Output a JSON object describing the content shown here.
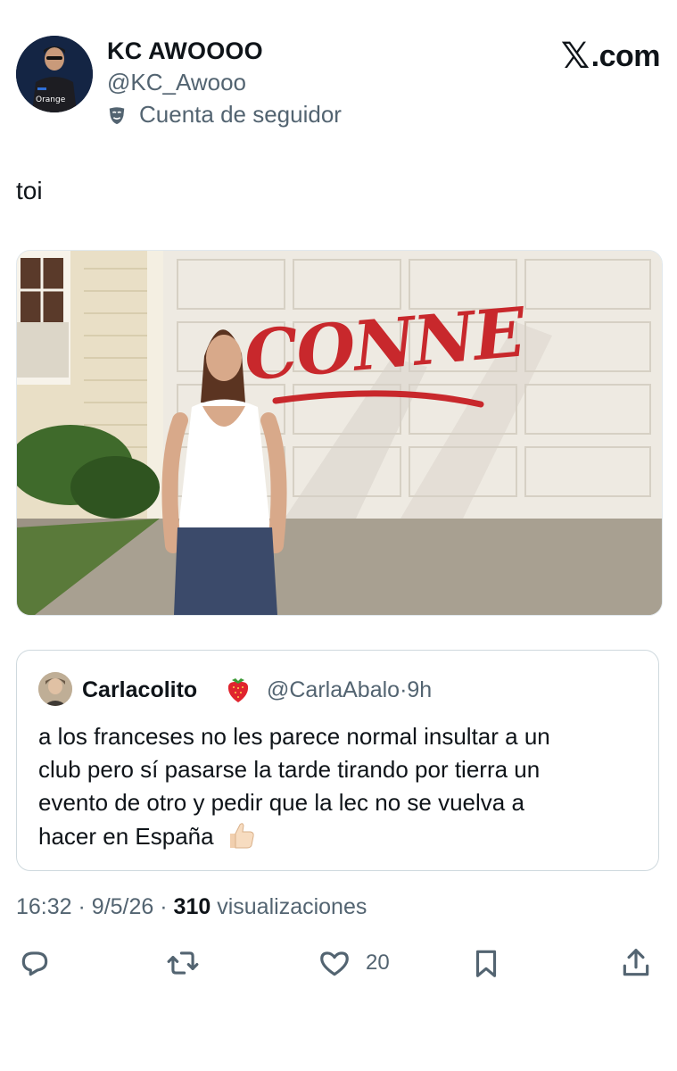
{
  "author": {
    "display_name": "KC AWOOOO",
    "handle": "@KC_Awooo",
    "account_type_label": "Cuenta de seguidor",
    "account_type_icon": "mask-icon"
  },
  "brand": {
    "x_glyph": "𝕏",
    "label": ".com"
  },
  "tweet": {
    "text": "toi",
    "media": {
      "description_icon": "photo",
      "painted_word": "CONNE"
    }
  },
  "quoted": {
    "display_name": "Carlacolito",
    "emoji": "strawberry",
    "handle": "@CarlaAbalo",
    "separator": "·",
    "time": "9h",
    "lines": [
      "a los franceses no les parece normal insultar a un",
      "club pero sí pasarse la tarde tirando por tierra un",
      "evento de otro y pedir que la lec no se vuelva a",
      "hacer en España"
    ],
    "trailing_emoji": "thumbs-up"
  },
  "meta": {
    "time": "16:32",
    "sep1": "·",
    "date": "9/5/26",
    "sep2": "·",
    "views_count": "310",
    "views_label": "visualizaciones"
  },
  "actions": {
    "reply_icon": "reply-icon",
    "retweet_icon": "retweet-icon",
    "like_icon": "heart-icon",
    "like_count": "20",
    "bookmark_icon": "bookmark-icon",
    "share_icon": "share-icon"
  },
  "colors": {
    "text_primary": "#0f1419",
    "text_secondary": "#536471",
    "border": "#cfd9de",
    "graffiti_red": "#c8282c"
  }
}
